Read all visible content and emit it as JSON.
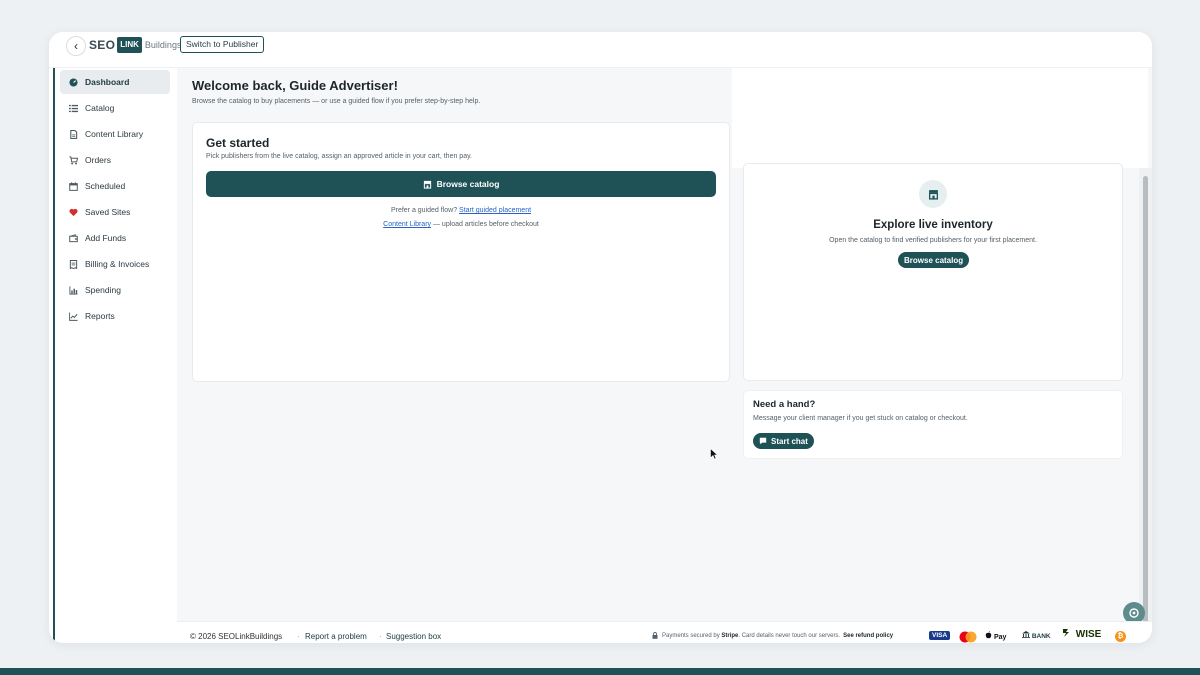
{
  "topbar": {
    "brand_seo": "SEO",
    "brand_link": "LINK",
    "brand_buildings": "Buildings",
    "switch_label": "Switch to Publisher"
  },
  "sidebar": {
    "items": [
      {
        "label": "Dashboard",
        "icon": "dashboard-icon",
        "active": true
      },
      {
        "label": "Catalog",
        "icon": "list-icon"
      },
      {
        "label": "Content Library",
        "icon": "document-icon"
      },
      {
        "label": "Orders",
        "icon": "cart-icon"
      },
      {
        "label": "Scheduled",
        "icon": "calendar-icon"
      },
      {
        "label": "Saved Sites",
        "icon": "heart-icon"
      },
      {
        "label": "Add Funds",
        "icon": "wallet-icon"
      },
      {
        "label": "Billing & Invoices",
        "icon": "invoice-icon"
      },
      {
        "label": "Spending",
        "icon": "bar-chart-icon"
      },
      {
        "label": "Reports",
        "icon": "line-chart-icon"
      }
    ]
  },
  "header": {
    "title": "Welcome back, Guide Advertiser!",
    "subtitle": "Browse the catalog to buy placements — or use a guided flow if you prefer step-by-step help."
  },
  "get_started": {
    "title": "Get started",
    "description": "Pick publishers from the live catalog, assign an approved article in your cart, then pay.",
    "button_label": "Browse catalog",
    "line1_prefix": "Prefer a guided flow?",
    "line1_link": "Start guided placement",
    "line2_link": "Content Library",
    "line2_suffix": "— upload articles before checkout"
  },
  "explore": {
    "title": "Explore live inventory",
    "description": "Open the catalog to find verified publishers for your first placement.",
    "button_label": "Browse catalog"
  },
  "help": {
    "title": "Need a hand?",
    "description": "Message your client manager if you get stuck on catalog or checkout.",
    "button_label": "Start chat"
  },
  "footer": {
    "copyright": "© 2026 SEOLinkBuildings",
    "report_link": "Report a problem",
    "suggestion_link": "Suggestion box",
    "secure_prefix": "Payments secured by",
    "secure_brand": "Stripe",
    "secure_suffix": ". Card details never touch our servers.",
    "refund_link": "See refund policy",
    "pay_visa": "VISA",
    "pay_apple": "Pay",
    "pay_bank": "BANK",
    "pay_wise": "WISE",
    "pay_btc": "₿"
  },
  "colors": {
    "primary": "#1f5257",
    "link": "#2a63c7",
    "heart": "#d32f2f"
  }
}
